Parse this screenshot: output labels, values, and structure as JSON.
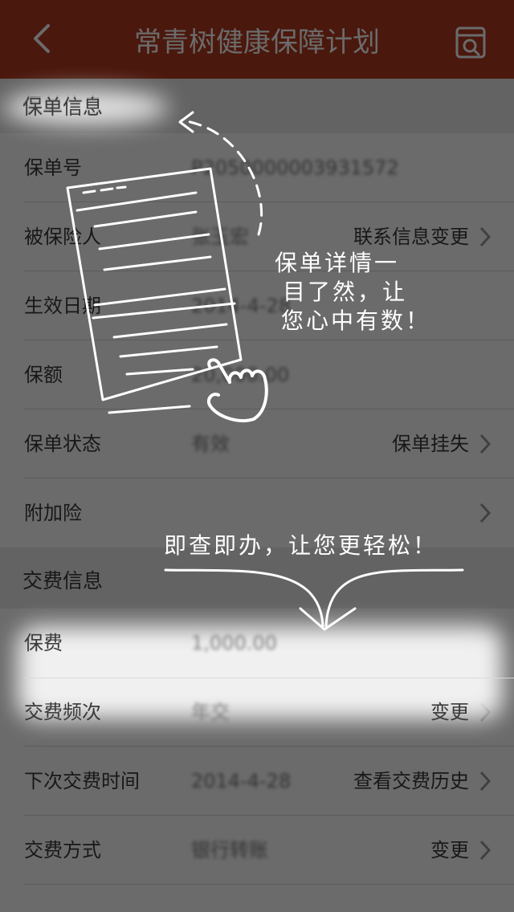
{
  "header": {
    "title": "常青树健康保障计划",
    "back_icon": "chevron-left-icon",
    "right_icon": "calendar-icon"
  },
  "policy_section": {
    "title": "保单信息",
    "rows": [
      {
        "label": "保单号",
        "value": "P2050000003931572",
        "action": ""
      },
      {
        "label": "被保险人",
        "value": "张玉宏",
        "action": "联系信息变更"
      },
      {
        "label": "生效日期",
        "value": "2014-4-28",
        "action": ""
      },
      {
        "label": "保额",
        "value": "20,000.00",
        "action": ""
      },
      {
        "label": "保单状态",
        "value": "有效",
        "action": "保单挂失"
      },
      {
        "label": "附加险",
        "value": "",
        "action": ""
      }
    ]
  },
  "payment_section": {
    "title": "交费信息",
    "rows": [
      {
        "label": "保费",
        "value": "1,000.00",
        "action": ""
      },
      {
        "label": "交费频次",
        "value": "年交",
        "action": "变更"
      },
      {
        "label": "下次交费时间",
        "value": "2014-4-28",
        "action": "查看交费历史"
      },
      {
        "label": "交费方式",
        "value": "银行转账",
        "action": "变更"
      }
    ]
  },
  "guide": {
    "hint_policy_line1": "保单详情一",
    "hint_policy_line2": "目了然，让",
    "hint_policy_line3": "您心中有数！",
    "hint_payment": "即查即办，让您更轻松！"
  },
  "colors": {
    "header_bg": "#b33a20",
    "overlay": "rgba(0,0,0,0.58)"
  }
}
